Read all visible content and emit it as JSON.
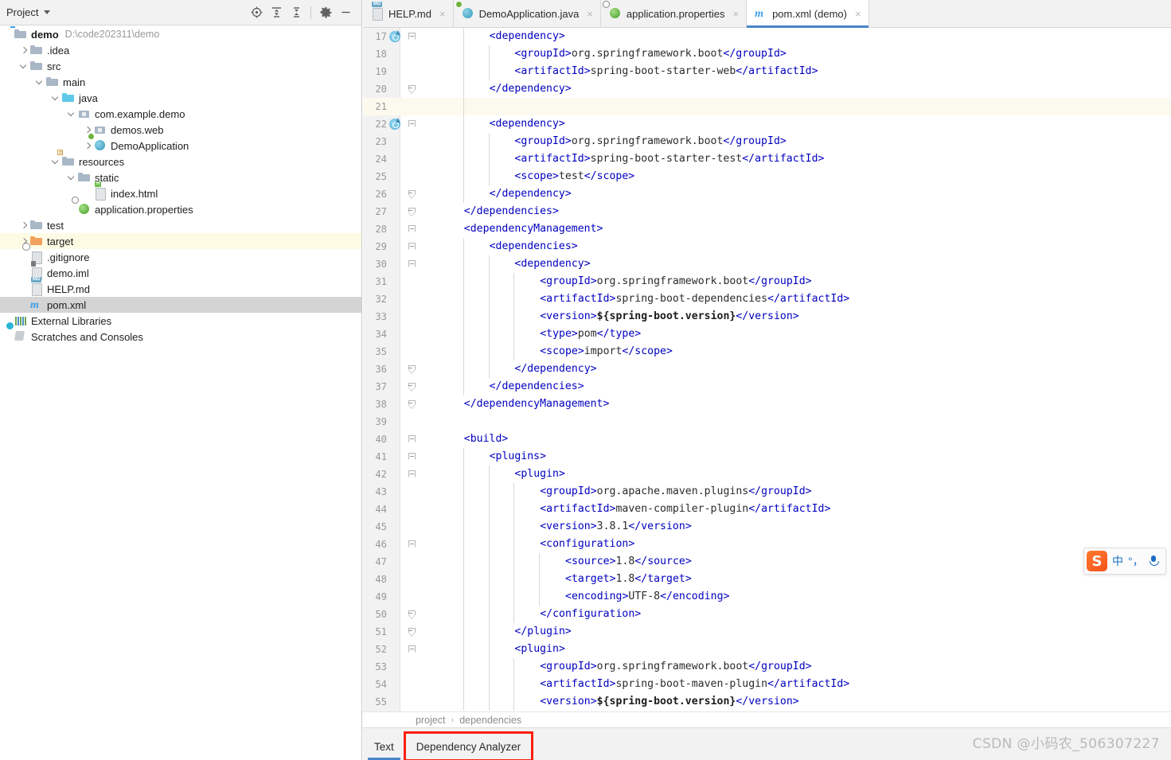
{
  "project_panel": {
    "title": "Project",
    "toolbar": [
      {
        "name": "locate-icon",
        "tooltip": "Select Opened File"
      },
      {
        "name": "expand-all-icon",
        "tooltip": "Expand All"
      },
      {
        "name": "collapse-all-icon",
        "tooltip": "Collapse All"
      },
      {
        "name": "gear-icon",
        "tooltip": "Settings"
      },
      {
        "name": "minimize-icon",
        "tooltip": "Hide"
      }
    ],
    "tree": [
      {
        "label": "demo",
        "hint": "D:\\code202311\\demo",
        "icon": "module-folder-icon",
        "indent": 0,
        "arrow": "none",
        "bold": true,
        "state": "normal"
      },
      {
        "label": ".idea",
        "hint": "",
        "icon": "folder-icon",
        "indent": 1,
        "arrow": "right",
        "bold": false,
        "state": "normal"
      },
      {
        "label": "src",
        "hint": "",
        "icon": "folder-icon",
        "indent": 1,
        "arrow": "down",
        "bold": false,
        "state": "normal"
      },
      {
        "label": "main",
        "hint": "",
        "icon": "folder-icon",
        "indent": 2,
        "arrow": "down",
        "bold": false,
        "state": "normal"
      },
      {
        "label": "java",
        "hint": "",
        "icon": "source-folder-icon",
        "indent": 3,
        "arrow": "down",
        "bold": false,
        "state": "normal"
      },
      {
        "label": "com.example.demo",
        "hint": "",
        "icon": "package-icon",
        "indent": 4,
        "arrow": "down",
        "bold": false,
        "state": "normal"
      },
      {
        "label": "demos.web",
        "hint": "",
        "icon": "package-icon",
        "indent": 5,
        "arrow": "right",
        "bold": false,
        "state": "normal"
      },
      {
        "label": "DemoApplication",
        "hint": "",
        "icon": "java-class-spring-icon",
        "indent": 5,
        "arrow": "right",
        "bold": false,
        "state": "normal"
      },
      {
        "label": "resources",
        "hint": "",
        "icon": "resources-folder-icon",
        "indent": 3,
        "arrow": "down",
        "bold": false,
        "state": "normal"
      },
      {
        "label": "static",
        "hint": "",
        "icon": "folder-icon",
        "indent": 4,
        "arrow": "down",
        "bold": false,
        "state": "normal"
      },
      {
        "label": "index.html",
        "hint": "",
        "icon": "html-file-icon",
        "indent": 5,
        "arrow": "none",
        "bold": false,
        "state": "normal"
      },
      {
        "label": "application.properties",
        "hint": "",
        "icon": "spring-properties-icon",
        "indent": 4,
        "arrow": "none",
        "bold": false,
        "state": "normal"
      },
      {
        "label": "test",
        "hint": "",
        "icon": "folder-icon",
        "indent": 1,
        "arrow": "right",
        "bold": false,
        "state": "normal"
      },
      {
        "label": "target",
        "hint": "",
        "icon": "excluded-folder-icon",
        "indent": 1,
        "arrow": "right",
        "bold": false,
        "state": "highlighted"
      },
      {
        "label": ".gitignore",
        "hint": "",
        "icon": "gitignore-file-icon",
        "indent": 1,
        "arrow": "none",
        "bold": false,
        "state": "normal"
      },
      {
        "label": "demo.iml",
        "hint": "",
        "icon": "iml-file-icon",
        "indent": 1,
        "arrow": "none",
        "bold": false,
        "state": "normal"
      },
      {
        "label": "HELP.md",
        "hint": "",
        "icon": "markdown-file-icon",
        "indent": 1,
        "arrow": "none",
        "bold": false,
        "state": "normal"
      },
      {
        "label": "pom.xml",
        "hint": "",
        "icon": "maven-file-icon",
        "indent": 1,
        "arrow": "none",
        "bold": false,
        "state": "selected"
      },
      {
        "label": "External Libraries",
        "hint": "",
        "icon": "libraries-icon",
        "indent": 0,
        "arrow": "none",
        "bold": false,
        "state": "normal"
      },
      {
        "label": "Scratches and Consoles",
        "hint": "",
        "icon": "scratches-icon",
        "indent": 0,
        "arrow": "none",
        "bold": false,
        "state": "normal"
      }
    ]
  },
  "editor_tabs": [
    {
      "label": "HELP.md",
      "icon": "markdown-file-icon",
      "active": false,
      "close": "×"
    },
    {
      "label": "DemoApplication.java",
      "icon": "java-class-spring-icon",
      "active": false,
      "close": "×"
    },
    {
      "label": "application.properties",
      "icon": "spring-properties-icon",
      "active": false,
      "close": "×"
    },
    {
      "label": "pom.xml (demo)",
      "icon": "maven-file-icon",
      "active": true,
      "close": "×"
    }
  ],
  "editor": {
    "file": "pom.xml",
    "first_line_number": 17,
    "current_line": 21,
    "lines": [
      {
        "n": 17,
        "indent": 2,
        "run": true,
        "fold": "top",
        "guides": [
          1
        ],
        "tokens": [
          [
            "tg",
            "<dependency>"
          ]
        ]
      },
      {
        "n": 18,
        "indent": 3,
        "run": false,
        "fold": "",
        "guides": [
          1,
          2
        ],
        "tokens": [
          [
            "tg",
            "<groupId>"
          ],
          [
            "txt",
            "org.springframework.boot"
          ],
          [
            "tg",
            "</groupId>"
          ]
        ]
      },
      {
        "n": 19,
        "indent": 3,
        "run": false,
        "fold": "",
        "guides": [
          1,
          2
        ],
        "tokens": [
          [
            "tg",
            "<artifactId>"
          ],
          [
            "txt",
            "spring-boot-starter-web"
          ],
          [
            "tg",
            "</artifactId>"
          ]
        ]
      },
      {
        "n": 20,
        "indent": 2,
        "run": false,
        "fold": "bottom",
        "guides": [
          1
        ],
        "tokens": [
          [
            "tg",
            "</dependency>"
          ]
        ]
      },
      {
        "n": 21,
        "indent": 0,
        "run": false,
        "fold": "",
        "guides": [
          1
        ],
        "tokens": []
      },
      {
        "n": 22,
        "indent": 2,
        "run": true,
        "fold": "top",
        "guides": [
          1
        ],
        "tokens": [
          [
            "tg",
            "<dependency>"
          ]
        ]
      },
      {
        "n": 23,
        "indent": 3,
        "run": false,
        "fold": "",
        "guides": [
          1,
          2
        ],
        "tokens": [
          [
            "tg",
            "<groupId>"
          ],
          [
            "txt",
            "org.springframework.boot"
          ],
          [
            "tg",
            "</groupId>"
          ]
        ]
      },
      {
        "n": 24,
        "indent": 3,
        "run": false,
        "fold": "",
        "guides": [
          1,
          2
        ],
        "tokens": [
          [
            "tg",
            "<artifactId>"
          ],
          [
            "txt",
            "spring-boot-starter-test"
          ],
          [
            "tg",
            "</artifactId>"
          ]
        ]
      },
      {
        "n": 25,
        "indent": 3,
        "run": false,
        "fold": "",
        "guides": [
          1,
          2
        ],
        "tokens": [
          [
            "tg",
            "<scope>"
          ],
          [
            "txt",
            "test"
          ],
          [
            "tg",
            "</scope>"
          ]
        ]
      },
      {
        "n": 26,
        "indent": 2,
        "run": false,
        "fold": "bottom",
        "guides": [
          1
        ],
        "tokens": [
          [
            "tg",
            "</dependency>"
          ]
        ]
      },
      {
        "n": 27,
        "indent": 1,
        "run": false,
        "fold": "bottom",
        "guides": [],
        "tokens": [
          [
            "tg",
            "</dependencies>"
          ]
        ]
      },
      {
        "n": 28,
        "indent": 1,
        "run": false,
        "fold": "top",
        "guides": [],
        "tokens": [
          [
            "tg",
            "<dependencyManagement>"
          ]
        ]
      },
      {
        "n": 29,
        "indent": 2,
        "run": false,
        "fold": "top",
        "guides": [
          1
        ],
        "tokens": [
          [
            "tg",
            "<dependencies>"
          ]
        ]
      },
      {
        "n": 30,
        "indent": 3,
        "run": false,
        "fold": "top",
        "guides": [
          1,
          2
        ],
        "tokens": [
          [
            "tg",
            "<dependency>"
          ]
        ]
      },
      {
        "n": 31,
        "indent": 4,
        "run": false,
        "fold": "",
        "guides": [
          1,
          2,
          3
        ],
        "tokens": [
          [
            "tg",
            "<groupId>"
          ],
          [
            "txt",
            "org.springframework.boot"
          ],
          [
            "tg",
            "</groupId>"
          ]
        ]
      },
      {
        "n": 32,
        "indent": 4,
        "run": false,
        "fold": "",
        "guides": [
          1,
          2,
          3
        ],
        "tokens": [
          [
            "tg",
            "<artifactId>"
          ],
          [
            "txt",
            "spring-boot-dependencies"
          ],
          [
            "tg",
            "</artifactId>"
          ]
        ]
      },
      {
        "n": 33,
        "indent": 4,
        "run": false,
        "fold": "",
        "guides": [
          1,
          2,
          3
        ],
        "tokens": [
          [
            "tg",
            "<version>"
          ],
          [
            "bld",
            "${spring-boot.version}"
          ],
          [
            "tg",
            "</version>"
          ]
        ]
      },
      {
        "n": 34,
        "indent": 4,
        "run": false,
        "fold": "",
        "guides": [
          1,
          2,
          3
        ],
        "tokens": [
          [
            "tg",
            "<type>"
          ],
          [
            "txt",
            "pom"
          ],
          [
            "tg",
            "</type>"
          ]
        ]
      },
      {
        "n": 35,
        "indent": 4,
        "run": false,
        "fold": "",
        "guides": [
          1,
          2,
          3
        ],
        "tokens": [
          [
            "tg",
            "<scope>"
          ],
          [
            "txt",
            "import"
          ],
          [
            "tg",
            "</scope>"
          ]
        ]
      },
      {
        "n": 36,
        "indent": 3,
        "run": false,
        "fold": "bottom",
        "guides": [
          1,
          2
        ],
        "tokens": [
          [
            "tg",
            "</dependency>"
          ]
        ]
      },
      {
        "n": 37,
        "indent": 2,
        "run": false,
        "fold": "bottom",
        "guides": [
          1
        ],
        "tokens": [
          [
            "tg",
            "</dependencies>"
          ]
        ]
      },
      {
        "n": 38,
        "indent": 1,
        "run": false,
        "fold": "bottom",
        "guides": [],
        "tokens": [
          [
            "tg",
            "</dependencyManagement>"
          ]
        ]
      },
      {
        "n": 39,
        "indent": 0,
        "run": false,
        "fold": "",
        "guides": [],
        "tokens": []
      },
      {
        "n": 40,
        "indent": 1,
        "run": false,
        "fold": "top",
        "guides": [],
        "tokens": [
          [
            "tg",
            "<build>"
          ]
        ]
      },
      {
        "n": 41,
        "indent": 2,
        "run": false,
        "fold": "top",
        "guides": [
          1
        ],
        "tokens": [
          [
            "tg",
            "<plugins>"
          ]
        ]
      },
      {
        "n": 42,
        "indent": 3,
        "run": false,
        "fold": "top",
        "guides": [
          1,
          2
        ],
        "tokens": [
          [
            "tg",
            "<plugin>"
          ]
        ]
      },
      {
        "n": 43,
        "indent": 4,
        "run": false,
        "fold": "",
        "guides": [
          1,
          2,
          3
        ],
        "tokens": [
          [
            "tg",
            "<groupId>"
          ],
          [
            "txt",
            "org.apache.maven.plugins"
          ],
          [
            "tg",
            "</groupId>"
          ]
        ]
      },
      {
        "n": 44,
        "indent": 4,
        "run": false,
        "fold": "",
        "guides": [
          1,
          2,
          3
        ],
        "tokens": [
          [
            "tg",
            "<artifactId>"
          ],
          [
            "txt",
            "maven-compiler-plugin"
          ],
          [
            "tg",
            "</artifactId>"
          ]
        ]
      },
      {
        "n": 45,
        "indent": 4,
        "run": false,
        "fold": "",
        "guides": [
          1,
          2,
          3
        ],
        "tokens": [
          [
            "tg",
            "<version>"
          ],
          [
            "txt",
            "3.8.1"
          ],
          [
            "tg",
            "</version>"
          ]
        ]
      },
      {
        "n": 46,
        "indent": 4,
        "run": false,
        "fold": "top",
        "guides": [
          1,
          2,
          3
        ],
        "tokens": [
          [
            "tg",
            "<configuration>"
          ]
        ]
      },
      {
        "n": 47,
        "indent": 5,
        "run": false,
        "fold": "",
        "guides": [
          1,
          2,
          3,
          4
        ],
        "tokens": [
          [
            "tg",
            "<source>"
          ],
          [
            "txt",
            "1.8"
          ],
          [
            "tg",
            "</source>"
          ]
        ]
      },
      {
        "n": 48,
        "indent": 5,
        "run": false,
        "fold": "",
        "guides": [
          1,
          2,
          3,
          4
        ],
        "tokens": [
          [
            "tg",
            "<target>"
          ],
          [
            "txt",
            "1.8"
          ],
          [
            "tg",
            "</target>"
          ]
        ]
      },
      {
        "n": 49,
        "indent": 5,
        "run": false,
        "fold": "",
        "guides": [
          1,
          2,
          3,
          4
        ],
        "tokens": [
          [
            "tg",
            "<encoding>"
          ],
          [
            "txt",
            "UTF-8"
          ],
          [
            "tg",
            "</encoding>"
          ]
        ]
      },
      {
        "n": 50,
        "indent": 4,
        "run": false,
        "fold": "bottom",
        "guides": [
          1,
          2,
          3
        ],
        "tokens": [
          [
            "tg",
            "</configuration>"
          ]
        ]
      },
      {
        "n": 51,
        "indent": 3,
        "run": false,
        "fold": "bottom",
        "guides": [
          1,
          2
        ],
        "tokens": [
          [
            "tg",
            "</plugin>"
          ]
        ]
      },
      {
        "n": 52,
        "indent": 3,
        "run": false,
        "fold": "top",
        "guides": [
          1,
          2
        ],
        "tokens": [
          [
            "tg",
            "<plugin>"
          ]
        ]
      },
      {
        "n": 53,
        "indent": 4,
        "run": false,
        "fold": "",
        "guides": [
          1,
          2,
          3
        ],
        "tokens": [
          [
            "tg",
            "<groupId>"
          ],
          [
            "txt",
            "org.springframework.boot"
          ],
          [
            "tg",
            "</groupId>"
          ]
        ]
      },
      {
        "n": 54,
        "indent": 4,
        "run": false,
        "fold": "",
        "guides": [
          1,
          2,
          3
        ],
        "tokens": [
          [
            "tg",
            "<artifactId>"
          ],
          [
            "txt",
            "spring-boot-maven-plugin"
          ],
          [
            "tg",
            "</artifactId>"
          ]
        ]
      },
      {
        "n": 55,
        "indent": 4,
        "run": false,
        "fold": "",
        "guides": [
          1,
          2,
          3
        ],
        "tokens": [
          [
            "tg",
            "<version>"
          ],
          [
            "bld",
            "${spring-boot.version}"
          ],
          [
            "tg",
            "</version>"
          ]
        ]
      }
    ]
  },
  "breadcrumb": {
    "items": [
      "project",
      "dependencies"
    ],
    "separator": "›"
  },
  "bottom_tabs": [
    {
      "label": "Text",
      "active": true,
      "highlighted": false
    },
    {
      "label": "Dependency Analyzer",
      "active": false,
      "highlighted": true
    }
  ],
  "watermark": "CSDN @小码农_506307227",
  "ime_bar": {
    "logo": "S",
    "mode": "中",
    "punctuation": "°，",
    "mic": "microphone-icon"
  },
  "colors": {
    "accent": "#4a86c8",
    "tag": "#0000c0",
    "text": "#2b2b2b",
    "highlight_row": "#fdfbe4",
    "selected_row": "#d4d4d4",
    "current_line": "#fcfaef",
    "ring": "#ff1f0f"
  }
}
